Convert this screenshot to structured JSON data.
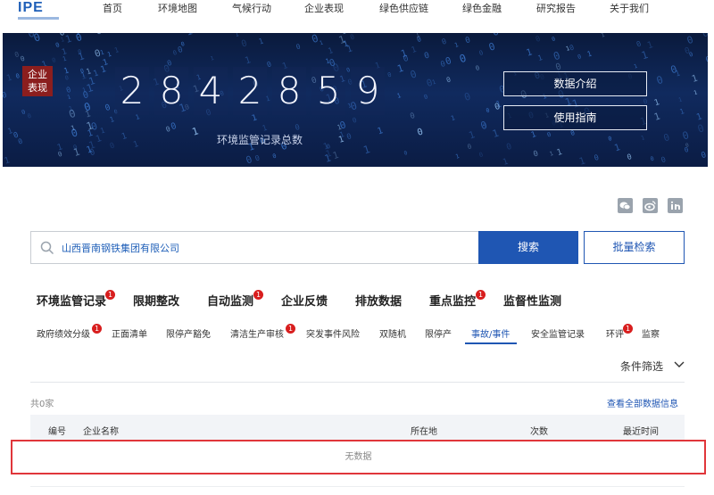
{
  "logo": {
    "text": "IPE"
  },
  "nav": [
    "首页",
    "环境地图",
    "气候行动",
    "企业表现",
    "绿色供应链",
    "绿色金融",
    "研究报告",
    "关于我们"
  ],
  "banner": {
    "ribbon": "企业\n表现",
    "counter_digits": [
      "2",
      "8",
      "4",
      "2",
      "8",
      "5",
      "9"
    ],
    "counter_label": "环境监管记录总数",
    "intro_button": "数据介绍",
    "guide_button": "使用指南"
  },
  "share_icons": [
    "wechat-icon",
    "weibo-icon",
    "linkedin-icon"
  ],
  "search": {
    "value": "山西晋南钢铁集团有限公司",
    "button": "搜索",
    "batch_button": "批量检索"
  },
  "main_tabs": [
    {
      "label": "环境监管记录",
      "badge": "1"
    },
    {
      "label": "限期整改",
      "badge": ""
    },
    {
      "label": "自动监测",
      "badge": "1"
    },
    {
      "label": "企业反馈",
      "badge": ""
    },
    {
      "label": "排放数据",
      "badge": ""
    },
    {
      "label": "重点监控",
      "badge": "1"
    },
    {
      "label": "监督性监测",
      "badge": ""
    }
  ],
  "sub_tabs": [
    {
      "label": "政府绩效分级",
      "badge": "1"
    },
    {
      "label": "正面清单",
      "badge": ""
    },
    {
      "label": "限停产豁免",
      "badge": ""
    },
    {
      "label": "清洁生产审核",
      "badge": "1"
    },
    {
      "label": "突发事件风险",
      "badge": ""
    },
    {
      "label": "双随机",
      "badge": ""
    },
    {
      "label": "限停产",
      "badge": ""
    },
    {
      "label": "事故/事件",
      "badge": ""
    },
    {
      "label": "安全监管记录",
      "badge": ""
    },
    {
      "label": "环评",
      "badge": "1"
    },
    {
      "label": "监察",
      "badge": ""
    }
  ],
  "active_sub_tab": "事故/事件",
  "filter_label": "条件筛选",
  "result_count": "共0家",
  "view_all": "查看全部数据信息",
  "table": {
    "headers": [
      "编号",
      "企业名称",
      "所在地",
      "次数",
      "最近时间"
    ],
    "empty_text": "无数据"
  },
  "colors": {
    "accent": "#1f56b3",
    "badge": "#d81e1e",
    "highlight_border": "#e0363a",
    "ribbon": "#8b1e1e"
  }
}
